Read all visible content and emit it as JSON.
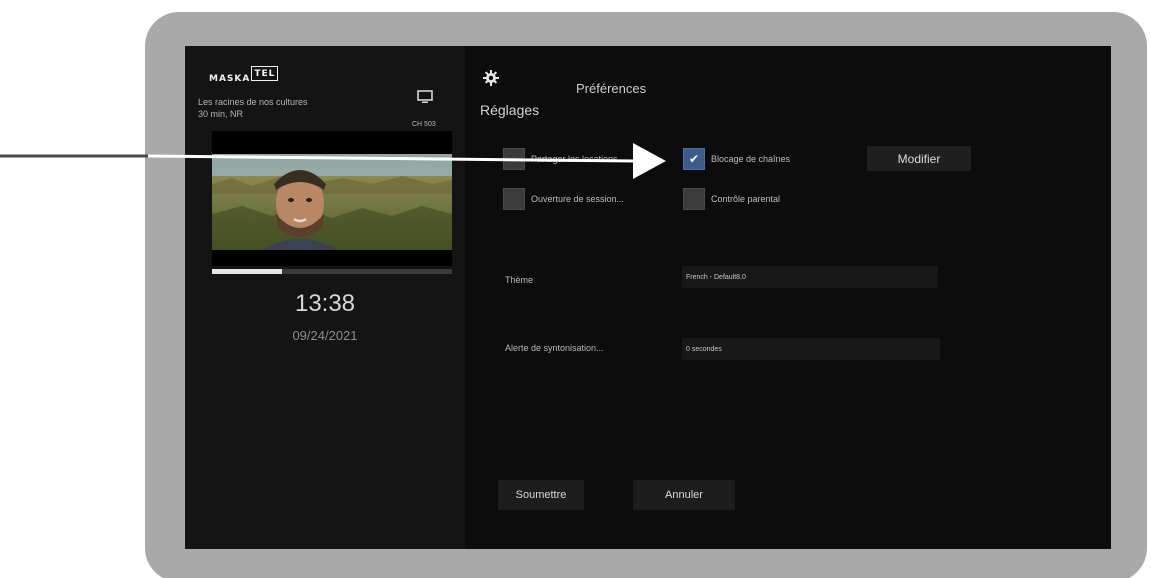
{
  "branding": {
    "logo_prefix": "MASKA",
    "logo_box": "TEL"
  },
  "now_playing": {
    "title": "Les racines de nos cultures",
    "meta": "30 min, NR",
    "channel": "CH 503",
    "progress": 0.29
  },
  "clock": {
    "time": "13:38",
    "date": "09/24/2021"
  },
  "settings": {
    "title": "Réglages",
    "tab": "Préférences",
    "options": [
      {
        "label": "Partager les locations",
        "checked": false
      },
      {
        "label": "Blocage de chaînes",
        "checked": true
      },
      {
        "label": "Ouverture de session...",
        "checked": false
      },
      {
        "label": "Contrôle parental",
        "checked": false
      }
    ],
    "modify_label": "Modifier",
    "theme_label": "Thème",
    "theme_value": "French - Default8.0",
    "alert_label": "Alerte de syntonisation...",
    "alert_value": "0 secondes",
    "submit_label": "Soumettre",
    "cancel_label": "Annuler"
  },
  "colors": {
    "screen_bg": "#0c0c0c",
    "frame": "#a9a9a9",
    "checkbox_checked": "#3d5a8a",
    "annotation": "#4a4a4a"
  },
  "icons": [
    "tv-icon",
    "gear-icon",
    "checkmark-icon",
    "arrow-annotation"
  ]
}
